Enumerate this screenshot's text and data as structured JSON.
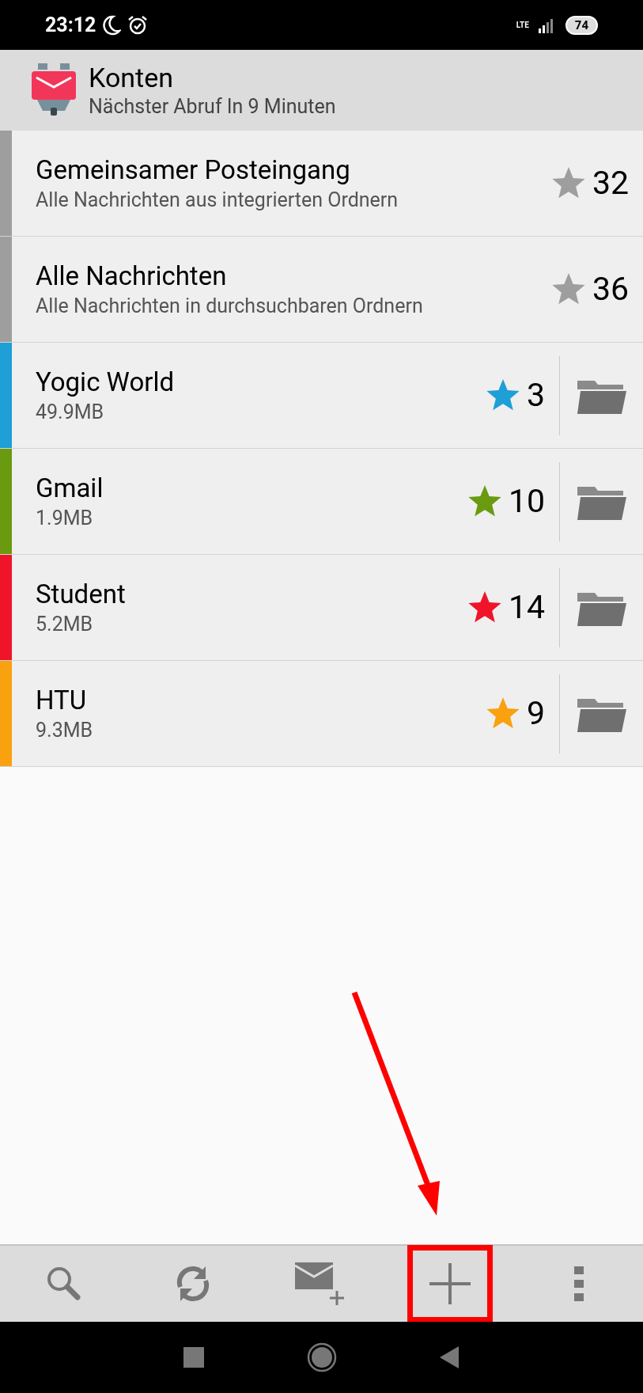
{
  "status_bar": {
    "time": "23:12",
    "network": "LTE",
    "battery": "74"
  },
  "app_bar": {
    "title": "Konten",
    "subtitle": "Nächster Abruf In 9 Minuten"
  },
  "accounts": [
    {
      "kind": "unified",
      "name": "Gemeinsamer Posteingang",
      "detail": "Alle Nachrichten aus integrierten Ordnern",
      "count": "32",
      "color": "#9e9e9e"
    },
    {
      "kind": "unified",
      "name": "Alle Nachrichten",
      "detail": "Alle Nachrichten in durchsuchbaren Ordnern",
      "count": "36",
      "color": "#9e9e9e"
    },
    {
      "kind": "account",
      "name": "Yogic World",
      "detail": "49.9MB",
      "count": "3",
      "color": "#1e9fd6"
    },
    {
      "kind": "account",
      "name": "Gmail",
      "detail": "1.9MB",
      "count": "10",
      "color": "#6a9a0f"
    },
    {
      "kind": "account",
      "name": "Student",
      "detail": "5.2MB",
      "count": "14",
      "color": "#f0142a"
    },
    {
      "kind": "account",
      "name": "HTU",
      "detail": "9.3MB",
      "count": "9",
      "color": "#f9a10f"
    }
  ],
  "toolbar": [
    {
      "kind": "search",
      "highlighted": false
    },
    {
      "kind": "refresh",
      "highlighted": false
    },
    {
      "kind": "compose",
      "highlighted": false
    },
    {
      "kind": "add",
      "highlighted": true
    },
    {
      "kind": "more",
      "highlighted": false
    }
  ]
}
